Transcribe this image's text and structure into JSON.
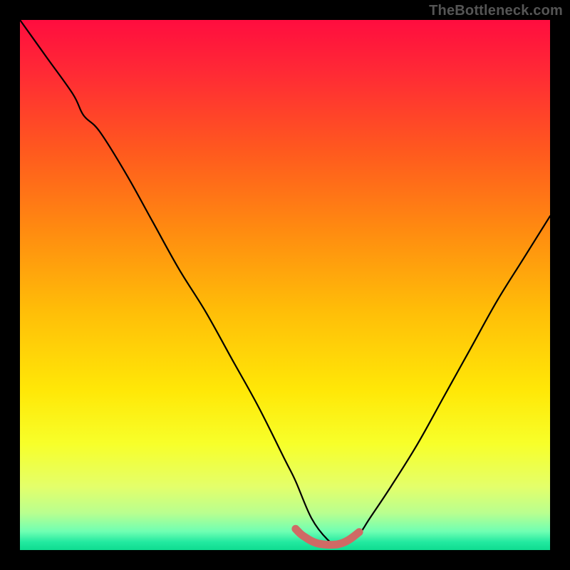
{
  "watermark": "TheBottleneck.com",
  "colors": {
    "frame": "#000000",
    "curve_stroke": "#000000",
    "trough_marker": "#cf6a65",
    "gradient_stops": [
      {
        "offset": 0.0,
        "color": "#ff0d3f"
      },
      {
        "offset": 0.1,
        "color": "#ff2a35"
      },
      {
        "offset": 0.25,
        "color": "#ff5a1e"
      },
      {
        "offset": 0.4,
        "color": "#ff8c10"
      },
      {
        "offset": 0.55,
        "color": "#ffbe08"
      },
      {
        "offset": 0.7,
        "color": "#ffe807"
      },
      {
        "offset": 0.8,
        "color": "#f7ff2a"
      },
      {
        "offset": 0.88,
        "color": "#e4ff6a"
      },
      {
        "offset": 0.93,
        "color": "#b9ff8f"
      },
      {
        "offset": 0.965,
        "color": "#6fffb3"
      },
      {
        "offset": 0.985,
        "color": "#22e9a0"
      },
      {
        "offset": 1.0,
        "color": "#0fdc90"
      }
    ]
  },
  "chart_data": {
    "type": "line",
    "title": "",
    "xlabel": "",
    "ylabel": "",
    "xlim": [
      0,
      100
    ],
    "ylim": [
      0,
      100
    ],
    "grid": false,
    "legend_position": "none",
    "annotations": [
      "TheBottleneck.com"
    ],
    "series": [
      {
        "name": "bottleneck-curve",
        "x": [
          0,
          5,
          10,
          12,
          15,
          20,
          25,
          30,
          35,
          40,
          45,
          50,
          52,
          55,
          58,
          60,
          62,
          64,
          66,
          70,
          75,
          80,
          85,
          90,
          95,
          100
        ],
        "y": [
          100,
          93,
          86,
          82,
          79,
          71,
          62,
          53,
          45,
          36,
          27,
          17,
          13,
          6,
          2,
          1,
          1.5,
          3,
          6,
          12,
          20,
          29,
          38,
          47,
          55,
          63
        ]
      },
      {
        "name": "trough-marker",
        "x": [
          52,
          53,
          54,
          55,
          56,
          57,
          58,
          59,
          60,
          61,
          62,
          63,
          64
        ],
        "y": [
          4,
          3,
          2.3,
          1.7,
          1.3,
          1.1,
          1,
          1,
          1.1,
          1.4,
          1.9,
          2.6,
          3.4
        ]
      }
    ]
  }
}
